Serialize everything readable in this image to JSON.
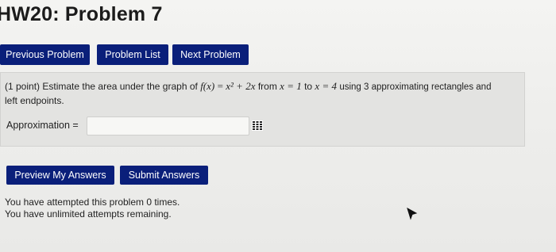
{
  "page": {
    "title": "HW20: Problem 7"
  },
  "nav": {
    "previous_label": "Previous Problem",
    "list_label": "Problem List",
    "next_label": "Next Problem"
  },
  "problem": {
    "points": "(1 point)",
    "intro": "Estimate the area under the graph of",
    "f_label": "f(x)",
    "equals": "=",
    "expr": "x² + 2x",
    "from": "from",
    "x1": "x = 1",
    "to": "to",
    "x2": "x = 4",
    "using": "using 3 approximating rectangles and",
    "line2": "left endpoints.",
    "answer_label": "Approximation =",
    "answer_value": ""
  },
  "actions": {
    "preview_label": "Preview My Answers",
    "submit_label": "Submit Answers"
  },
  "status": {
    "attempted": "You have attempted this problem 0 times.",
    "remaining": "You have unlimited attempts remaining."
  },
  "icons": {
    "keypad": "keypad-icon",
    "cursor": "mouse-cursor-icon"
  },
  "colors": {
    "button_bg": "#0a1f7a",
    "button_text": "#ffffff",
    "panel_bg": "#e3e3e1"
  }
}
